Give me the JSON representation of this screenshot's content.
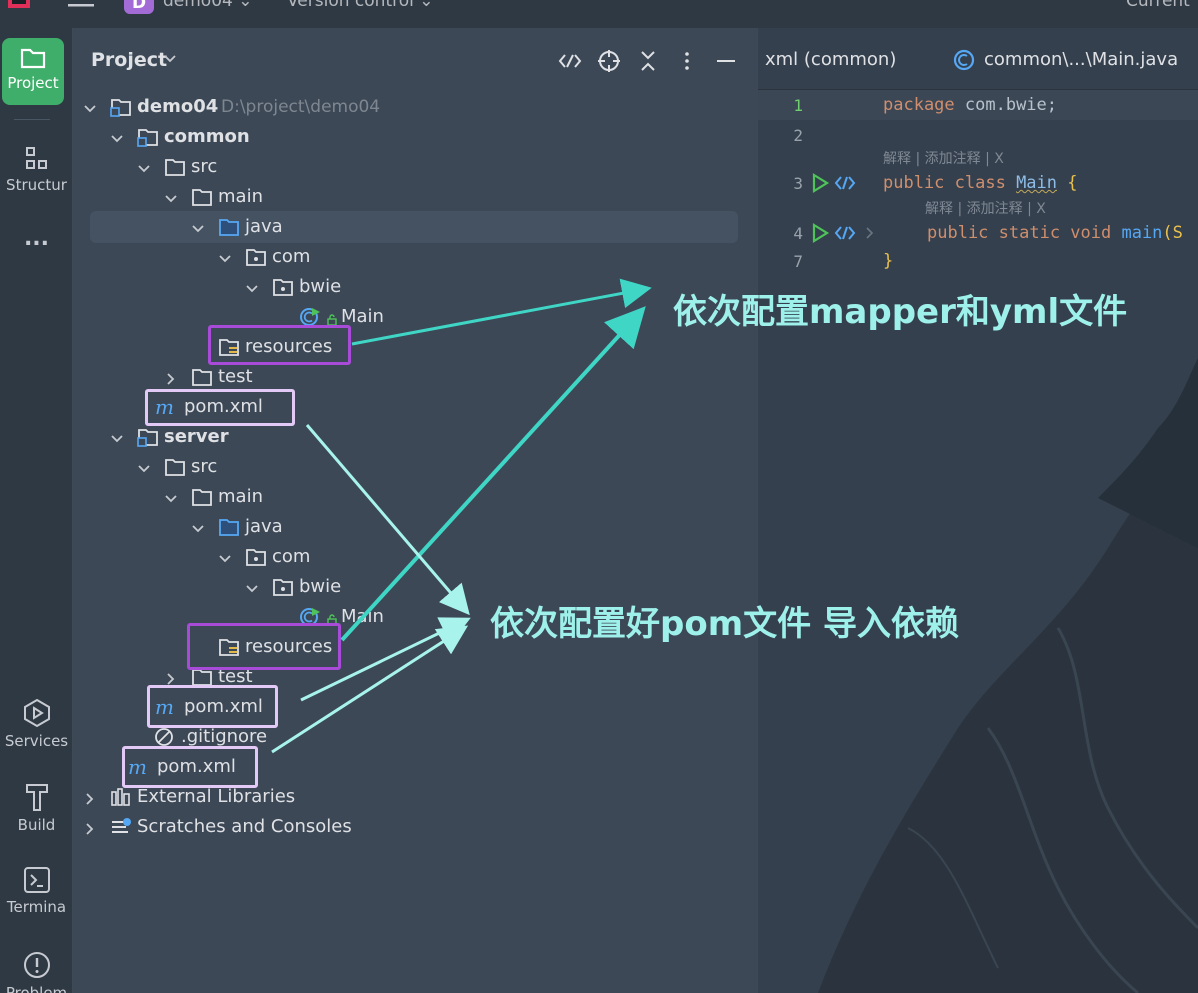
{
  "topbar": {
    "project_badge": "D",
    "project_name": "demo04",
    "version_control": "Version control",
    "current_file": "Current"
  },
  "tool_window_bar": {
    "project": "Project",
    "structure": "Structur",
    "more": "...",
    "services": "Services",
    "build": "Build",
    "terminal": "Termina",
    "problems": "Problem"
  },
  "project_panel": {
    "title": "Project",
    "tree": [
      {
        "label": "demo04",
        "path": "D:\\project\\demo04"
      },
      {
        "label": "common"
      },
      {
        "label": "src"
      },
      {
        "label": "main"
      },
      {
        "label": "java"
      },
      {
        "label": "com"
      },
      {
        "label": "bwie"
      },
      {
        "label": "Main"
      },
      {
        "label": "resources"
      },
      {
        "label": "test"
      },
      {
        "label": "pom.xml"
      },
      {
        "label": "server"
      },
      {
        "label": "src"
      },
      {
        "label": "main"
      },
      {
        "label": "java"
      },
      {
        "label": "com"
      },
      {
        "label": "bwie"
      },
      {
        "label": "Main"
      },
      {
        "label": "resources"
      },
      {
        "label": "test"
      },
      {
        "label": "pom.xml"
      },
      {
        "label": ".gitignore"
      },
      {
        "label": "pom.xml"
      },
      {
        "label": "External Libraries"
      },
      {
        "label": "Scratches and Consoles"
      }
    ]
  },
  "editor": {
    "tabs": [
      "xml (common)",
      "common\\...\\Main.java"
    ],
    "line_numbers": [
      "1",
      "2",
      "3",
      "4",
      "7"
    ],
    "code": {
      "l1_kw": "package",
      "l1_pkg": " com.bwie;",
      "l3_kw": "public class ",
      "l3_cls": "Main",
      "l3_brace": " {",
      "l4_kw": "public static void ",
      "l4_fn": "main",
      "l4_rest": "(S",
      "l7_brace": "}"
    },
    "hint_1": "解释 | 添加注释 | X",
    "hint_2": "解释 | 添加注释 | X"
  },
  "annotations": {
    "yml": "依次配置mapper和yml文件",
    "pom": "依次配置好pom文件 导入依赖"
  },
  "colors": {
    "accent_green": "#3fae6a",
    "annotation_purple": "#a84bd8",
    "annotation_light": "#e3c9f5",
    "arrow_teal": "#3fd6c6",
    "arrow_light": "#a8f4ec"
  }
}
